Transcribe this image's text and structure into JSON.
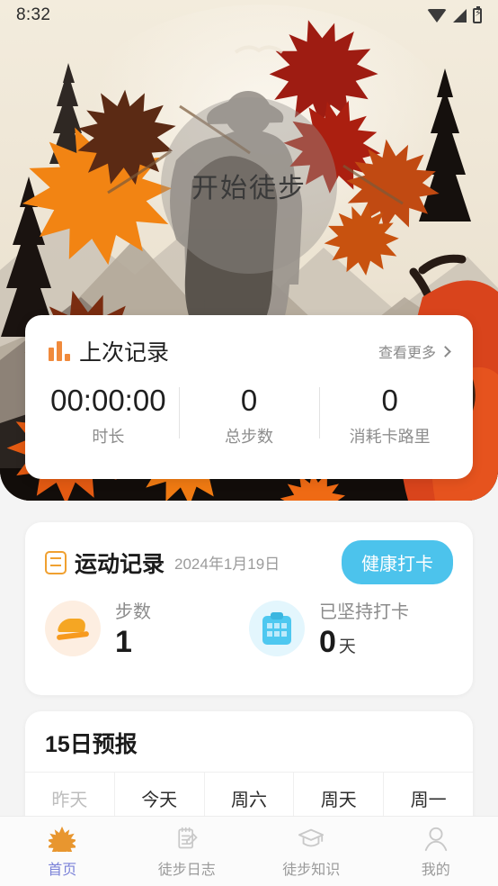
{
  "statusbar": {
    "time": "8:32",
    "icons": [
      "wifi-icon",
      "signal-icon",
      "battery-charging-icon"
    ]
  },
  "hero": {
    "start_label": "开始徒步",
    "art_description": "autumn-maple-forest-hiker-silhouette"
  },
  "last_record": {
    "icon": "bar-chart-icon",
    "title": "上次记录",
    "more_label": "查看更多",
    "more_icon": "chevron-right-icon",
    "stats": [
      {
        "value": "00:00:00",
        "label": "时长"
      },
      {
        "value": "0",
        "label": "总步数"
      },
      {
        "value": "0",
        "label": "消耗卡路里"
      }
    ]
  },
  "exercise": {
    "icon": "document-list-icon",
    "title": "运动记录",
    "date": "2024年1月19日",
    "checkin_label": "健康打卡",
    "items": [
      {
        "icon": "shoe-icon",
        "label": "步数",
        "value": "1",
        "unit": ""
      },
      {
        "icon": "clipboard-check-icon",
        "label": "已坚持打卡",
        "value": "0",
        "unit": "天"
      }
    ]
  },
  "forecast": {
    "title": "15日预报",
    "days": [
      {
        "label": "昨天",
        "past": true
      },
      {
        "label": "今天",
        "past": false
      },
      {
        "label": "周六",
        "past": false
      },
      {
        "label": "周天",
        "past": false
      },
      {
        "label": "周一",
        "past": false
      }
    ]
  },
  "tabbar": {
    "items": [
      {
        "label": "首页",
        "icon": "maple-leaf-icon",
        "active": true
      },
      {
        "label": "徒步日志",
        "icon": "clipboard-pen-icon",
        "active": false
      },
      {
        "label": "徒步知识",
        "icon": "graduation-cap-icon",
        "active": false
      },
      {
        "label": "我的",
        "icon": "person-icon",
        "active": false
      }
    ]
  },
  "colors": {
    "accent_orange": "#f0922f",
    "accent_blue": "#4cc3ec",
    "active_tab": "#7b82d8",
    "page_bg": "#f4f4f4",
    "card_bg": "#ffffff"
  }
}
